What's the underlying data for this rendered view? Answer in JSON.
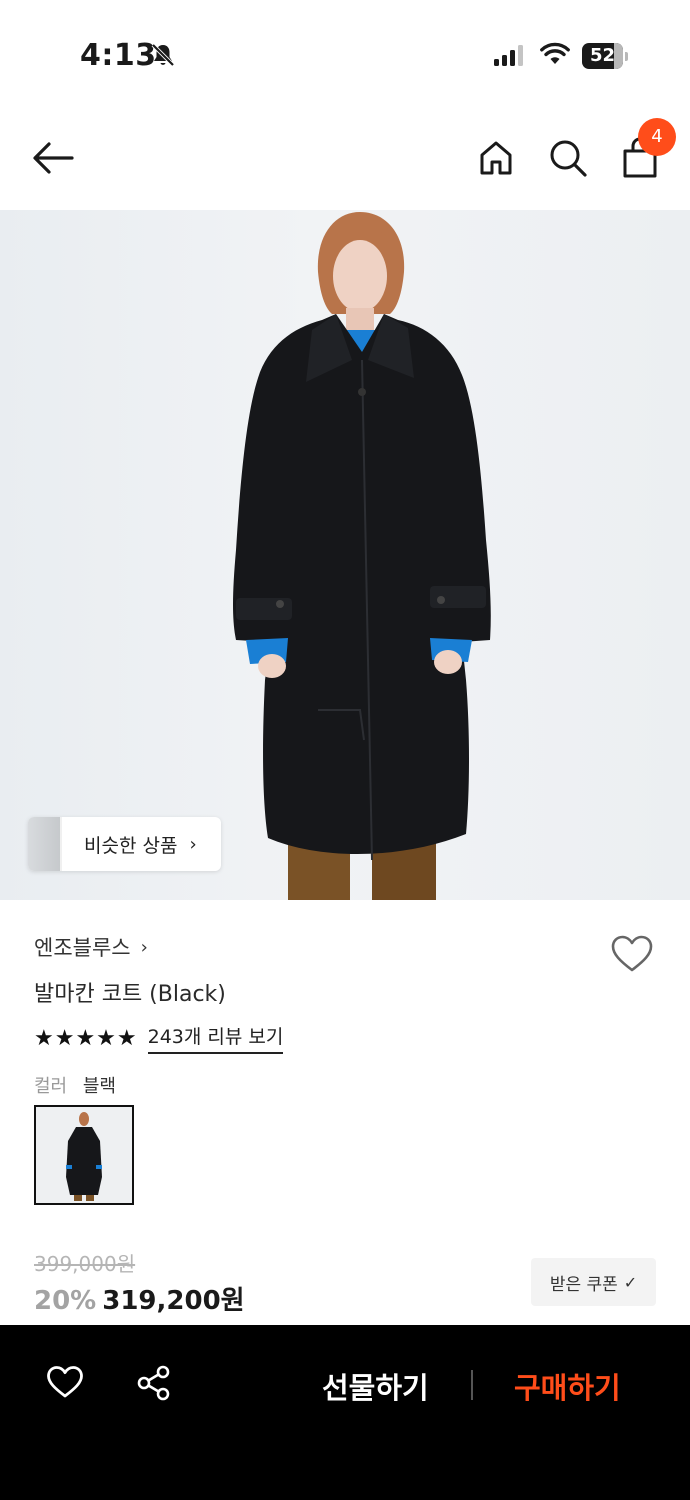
{
  "status_bar": {
    "time": "4:13",
    "battery": "52"
  },
  "nav": {
    "cart_count": "4"
  },
  "hero": {
    "similar_label": "비슷한 상품",
    "similar_chevron": "›"
  },
  "product": {
    "brand": "엔조블루스",
    "brand_chevron": "›",
    "name": "발마칸 코트 (Black)",
    "rating_stars": "★★★★★",
    "rating_value": 5,
    "reviews_link": "243개 리뷰 보기",
    "color_key": "컬러",
    "color_value": "블랙",
    "original_price": "399,000원",
    "discount": "20%",
    "sale_price": "319,200원",
    "coupon_label": "받은 쿠폰",
    "coupon_check": "✓"
  },
  "bottom_bar": {
    "gift_label": "선물하기",
    "buy_label": "구매하기"
  },
  "colors": {
    "accent": "#ff4d1a",
    "bottom_bar_bg": "#000000"
  }
}
